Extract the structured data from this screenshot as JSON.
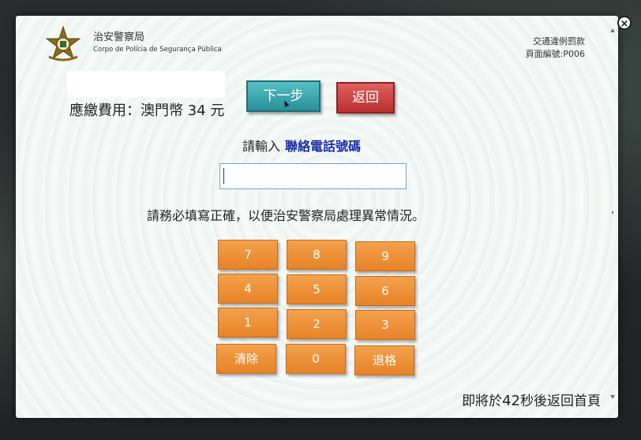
{
  "header": {
    "agency_zh": "治安警察局",
    "agency_pt": "Corpo de Polícia de Segurança Pública",
    "page_type": "交通違例罰款",
    "page_code": "頁面編號:P006"
  },
  "payment": {
    "fee_label": "應繳費用：澳門幣 34 元"
  },
  "buttons": {
    "next": "下一步",
    "back": "返回"
  },
  "form": {
    "prompt_prefix": "請輸入",
    "prompt_field": "聯絡電話號碼",
    "phone_value": "",
    "notice": "請務必填寫正確，以便治安警察局處理異常情況。"
  },
  "keypad": {
    "keys": [
      "7",
      "8",
      "9",
      "4",
      "5",
      "6",
      "1",
      "2",
      "3",
      "清除",
      "0",
      "退格"
    ]
  },
  "countdown": {
    "prefix": "即將於",
    "seconds": "42",
    "suffix": "秒後返回首頁"
  },
  "window": {
    "close_label": "×"
  },
  "colors": {
    "next_button": "#2a8f9a",
    "back_button": "#b93030",
    "keypad": "#e88327",
    "prompt_field": "#1a2fa8"
  }
}
